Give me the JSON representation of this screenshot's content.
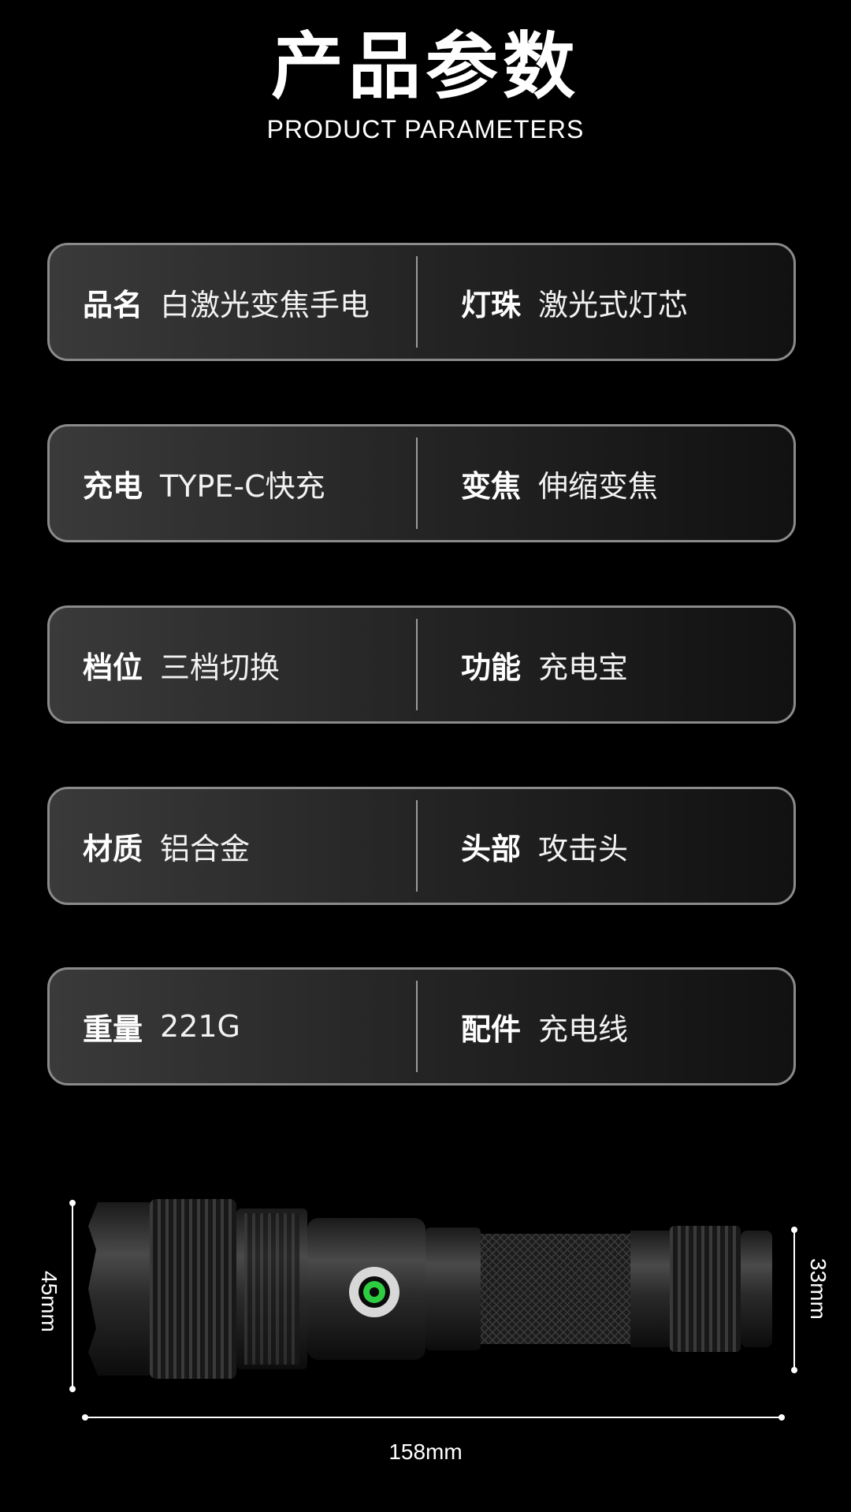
{
  "header": {
    "title": "产品参数",
    "subtitle": "PRODUCT PARAMETERS"
  },
  "params": [
    {
      "left": {
        "key": "品名",
        "value": "白激光变焦手电"
      },
      "right": {
        "key": "灯珠",
        "value": "激光式灯芯"
      }
    },
    {
      "left": {
        "key": "充电",
        "value": "TYPE-C快充"
      },
      "right": {
        "key": "变焦",
        "value": "伸缩变焦"
      }
    },
    {
      "left": {
        "key": "档位",
        "value": "三档切换"
      },
      "right": {
        "key": "功能",
        "value": "充电宝"
      }
    },
    {
      "left": {
        "key": "材质",
        "value": "铝合金"
      },
      "right": {
        "key": "头部",
        "value": "攻击头"
      }
    },
    {
      "left": {
        "key": "重量",
        "value": "221G"
      },
      "right": {
        "key": "配件",
        "value": "充电线"
      }
    }
  ],
  "dimensions": {
    "height_left": "45mm",
    "height_right": "33mm",
    "length": "158mm"
  },
  "colors": {
    "background": "#000000",
    "border": "#8a8a8a",
    "indicator": "#2ecc40"
  }
}
